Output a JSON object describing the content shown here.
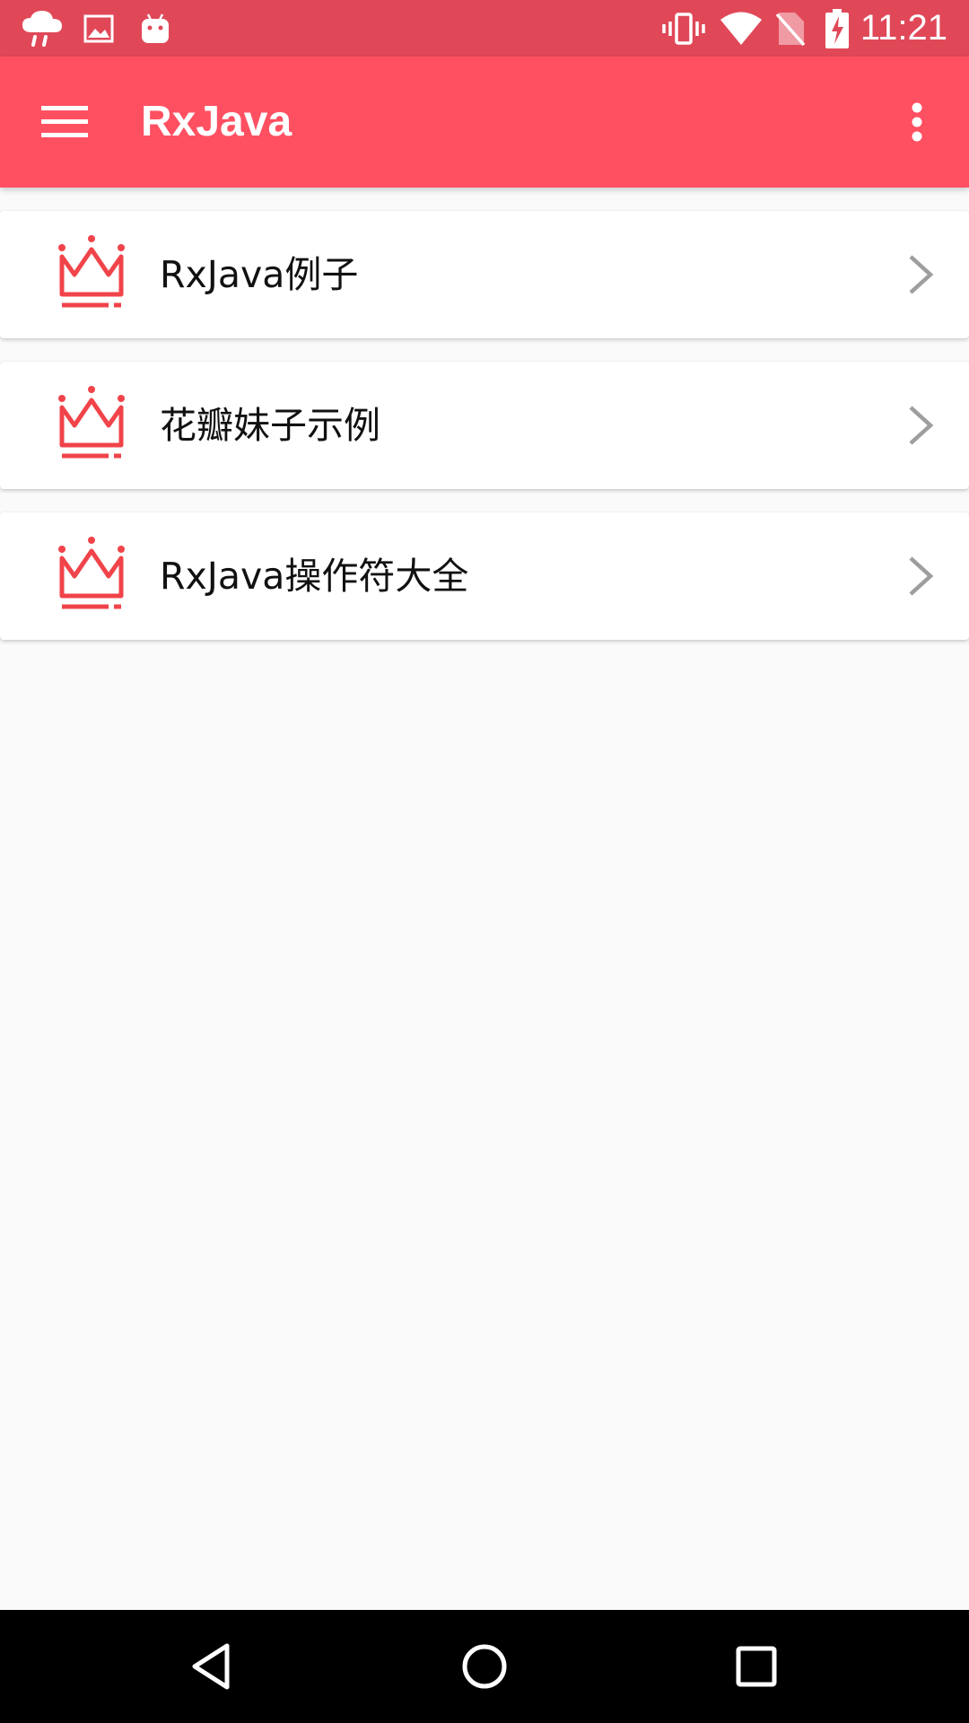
{
  "status_bar": {
    "time": "11:21",
    "left_icons": [
      "weather-rain-icon",
      "image-icon",
      "android-icon"
    ],
    "right_icons": [
      "vibrate-icon",
      "wifi-icon",
      "no-sim-icon",
      "battery-charging-icon"
    ]
  },
  "app_bar": {
    "title": "RxJava",
    "menu_icon": "hamburger-menu-icon",
    "overflow_icon": "more-vert-icon",
    "color": "#FF5062"
  },
  "list": {
    "items": [
      {
        "label": "RxJava例子",
        "icon": "crown-icon"
      },
      {
        "label": "花瓣妹子示例",
        "icon": "crown-icon"
      },
      {
        "label": "RxJava操作符大全",
        "icon": "crown-icon"
      }
    ],
    "accent": "#F0444A"
  },
  "nav_bar": {
    "buttons": [
      "back-icon",
      "home-icon",
      "recents-icon"
    ]
  }
}
